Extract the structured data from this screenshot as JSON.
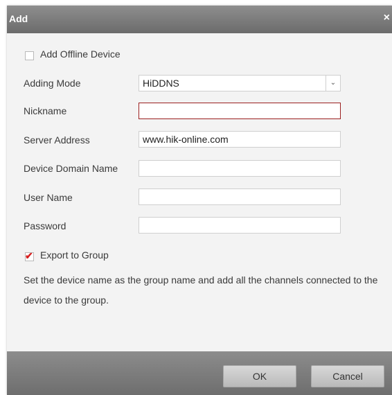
{
  "dialog": {
    "title": "Add",
    "close_glyph": "×"
  },
  "form": {
    "offline_label": "Add Offline Device",
    "offline_checked": false,
    "adding_mode_label": "Adding Mode",
    "adding_mode_value": "HiDDNS",
    "nickname_label": "Nickname",
    "nickname_value": "",
    "server_address_label": "Server Address",
    "server_address_value": "www.hik-online.com",
    "domain_label": "Device Domain Name",
    "domain_value": "",
    "username_label": "User Name",
    "username_value": "",
    "password_label": "Password",
    "password_value": "",
    "export_label": "Export to Group",
    "export_checked": true,
    "export_desc": "Set the device name as the group name and add all the channels connected to the device to the group."
  },
  "footer": {
    "ok_label": "OK",
    "cancel_label": "Cancel"
  },
  "colors": {
    "titlebar": "#7b7b7b",
    "error_border": "#9a1f1f",
    "checkmark": "#d62020"
  },
  "icons": {
    "close": "close-icon",
    "dropdown": "chevron-down-icon",
    "check": "checkmark-icon"
  }
}
